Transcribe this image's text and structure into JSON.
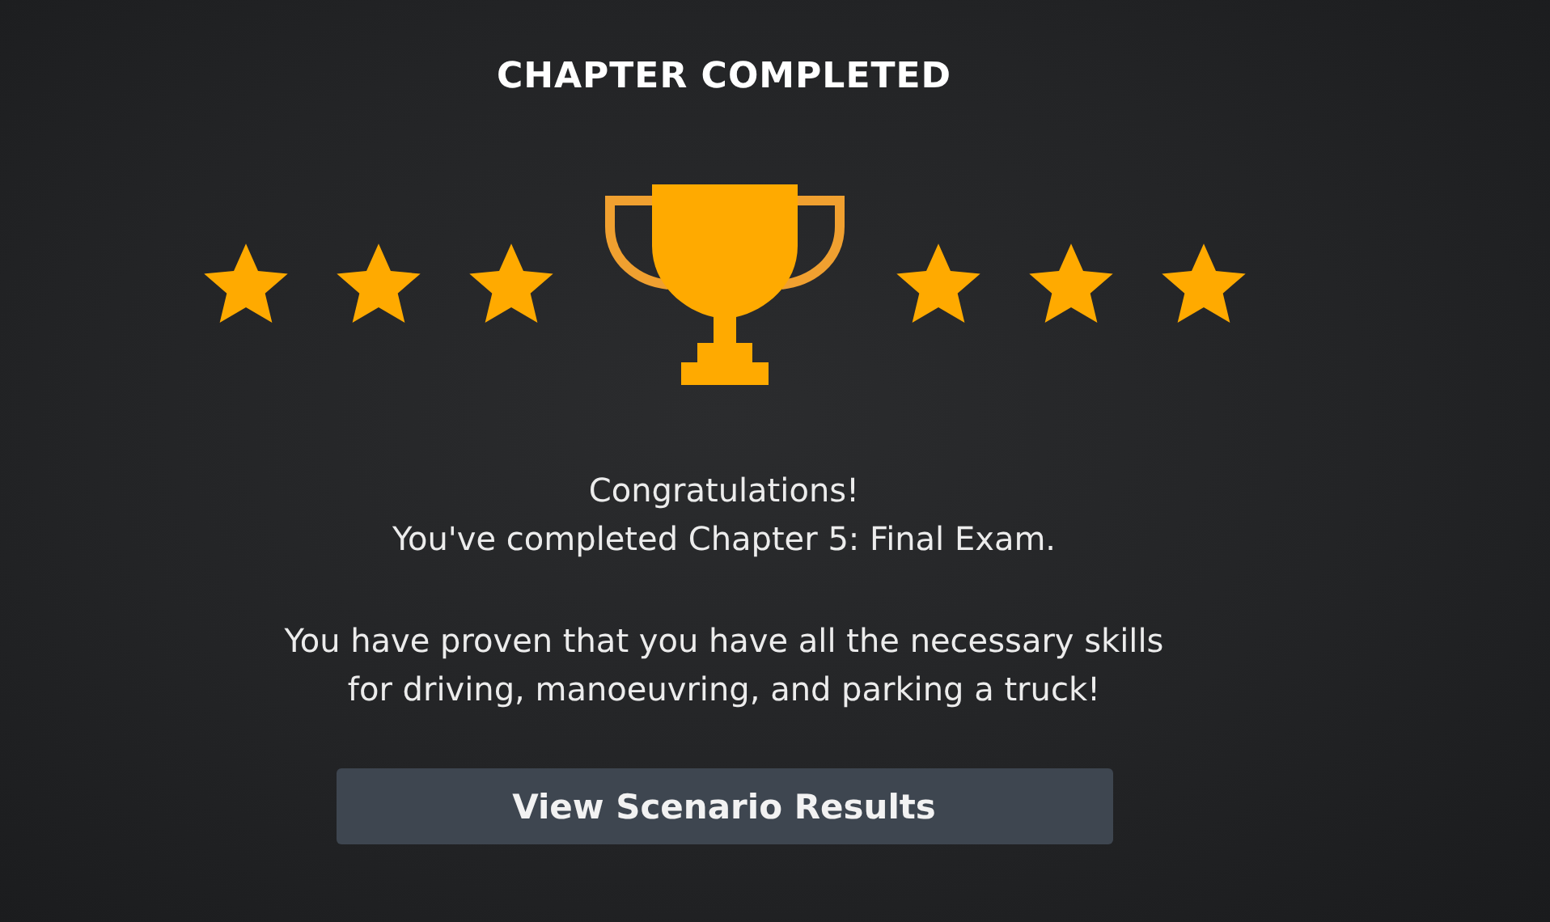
{
  "title": "CHAPTER COMPLETED",
  "award": {
    "left": {
      "stars": 3
    },
    "right": {
      "stars": 3
    }
  },
  "message": [
    "Congratulations!",
    "You've completed Chapter 5: Final Exam."
  ],
  "details": [
    "You have proven that you have all the necessary skills",
    "for driving, manoeuvring, and parking a truck!"
  ],
  "button": "View Scenario Results"
}
